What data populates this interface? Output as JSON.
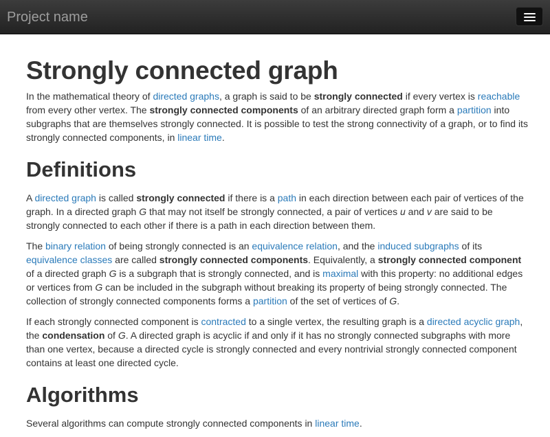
{
  "navbar": {
    "brand": "Project name",
    "toggle_icon": "hamburger-menu-icon"
  },
  "article": {
    "title": "Strongly connected graph",
    "intro": {
      "t1": "In the mathematical theory of ",
      "l1": "directed graphs",
      "t2": ", a graph is said to be ",
      "b1": "strongly connected",
      "t3": " if every vertex is ",
      "l2": "reachable",
      "t4": " from every other vertex. The ",
      "b2": "strongly connected components",
      "t5": " of an arbitrary directed graph form a ",
      "l3": "partition",
      "t6": " into subgraphs that are themselves strongly connected. It is possible to test the strong connectivity of a graph, or to find its strongly connected components, in ",
      "l4": "linear time",
      "t7": "."
    },
    "definitions": {
      "heading": "Definitions",
      "p1": {
        "t1": "A ",
        "l1": "directed graph",
        "t2": " is called ",
        "b1": "strongly connected",
        "t3": " if there is a ",
        "l2": "path",
        "t4": " in each direction between each pair of vertices of the graph. In a directed graph ",
        "i1": "G",
        "t5": " that may not itself be strongly connected, a pair of vertices ",
        "i2": "u",
        "t6": " and ",
        "i3": "v",
        "t7": " are said to be strongly connected to each other if there is a path in each direction between them."
      },
      "p2": {
        "t1": "The ",
        "l1": "binary relation",
        "t2": " of being strongly connected is an ",
        "l2": "equivalence relation",
        "t3": ", and the ",
        "l3": "induced subgraphs",
        "t4": " of its ",
        "l4": "equivalence classes",
        "t5": " are called ",
        "b1": "strongly connected components",
        "t6": ". Equivalently, a ",
        "b2": "strongly connected component",
        "t7": " of a directed graph ",
        "i1": "G",
        "t8": " is a subgraph that is strongly connected, and is ",
        "l5": "maximal",
        "t9": " with this property: no additional edges or vertices from ",
        "i2": "G",
        "t10": " can be included in the subgraph without breaking its property of being strongly connected. The collection of strongly connected components forms a ",
        "l6": "partition",
        "t11": " of the set of vertices of ",
        "i3": "G",
        "t12": "."
      },
      "p3": {
        "t1": "If each strongly connected component is ",
        "l1": "contracted",
        "t2": " to a single vertex, the resulting graph is a ",
        "l2": "directed acyclic graph",
        "t3": ", the ",
        "b1": "condensation",
        "t4": " of ",
        "i1": "G",
        "t5": ". A directed graph is acyclic if and only if it has no strongly connected subgraphs with more than one vertex, because a directed cycle is strongly connected and every nontrivial strongly connected component contains at least one directed cycle."
      }
    },
    "algorithms": {
      "heading": "Algorithms",
      "p1": {
        "t1": "Several algorithms can compute strongly connected components in ",
        "l1": "linear time",
        "t2": "."
      }
    }
  },
  "colors": {
    "navbar_bg": "#222222",
    "brand_text": "#9d9d9d",
    "link": "#2a7ab9",
    "body_text": "#333333"
  }
}
